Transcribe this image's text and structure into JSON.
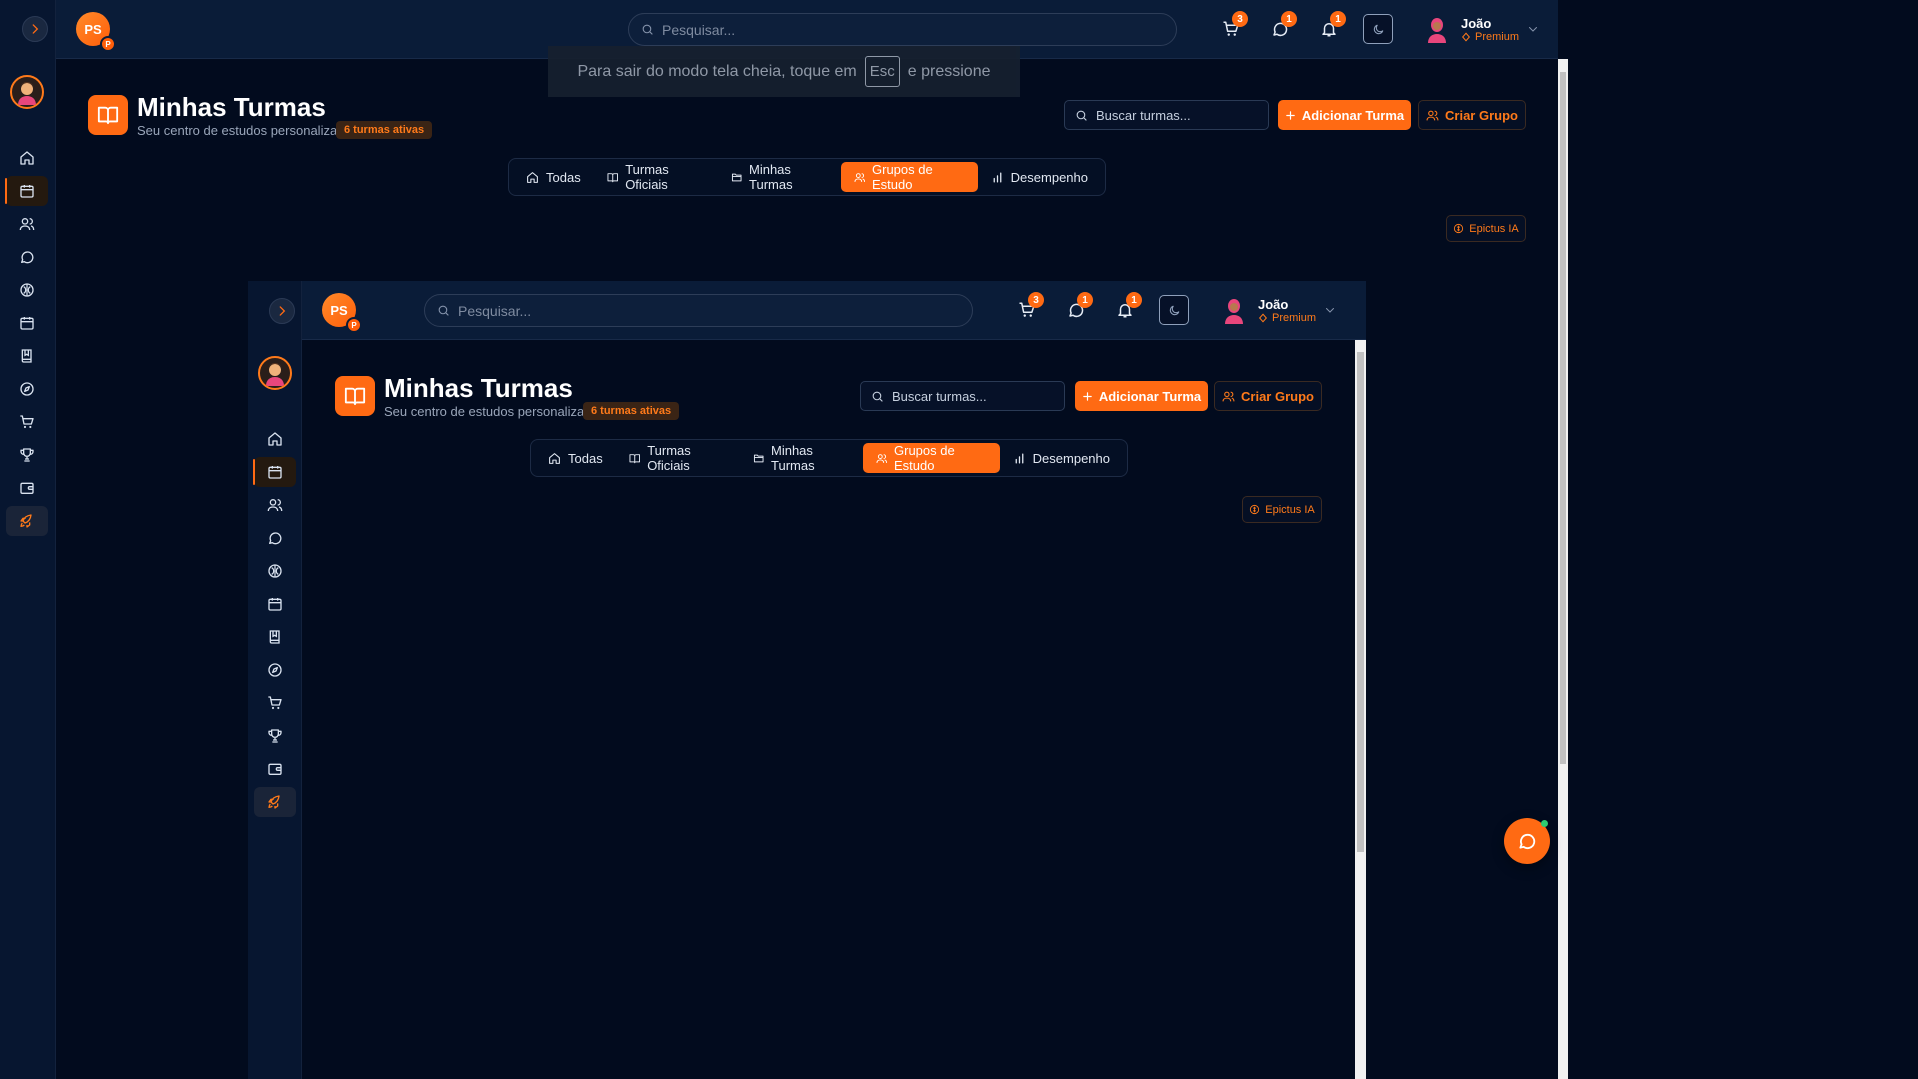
{
  "fullscreen_notice": {
    "before": "Para sair do modo tela cheia, toque em",
    "key": "Esc",
    "after": "e pressione"
  },
  "brand": {
    "initials": "PS",
    "sub": "P"
  },
  "search": {
    "placeholder": "Pesquisar..."
  },
  "counts": {
    "cart": "3",
    "messages": "1",
    "notifications": "1"
  },
  "user": {
    "name": "João",
    "plan": "Premium"
  },
  "sidebar": {
    "items": [
      "home-icon",
      "calendar-icon",
      "users-icon",
      "message-icon",
      "brain-icon",
      "calendar-icon",
      "book-icon",
      "compass-icon",
      "cart-icon",
      "trophy-icon",
      "wallet-icon",
      "rocket-icon"
    ],
    "active_index": 1
  },
  "page": {
    "title": "Minhas Turmas",
    "subtitle": "Seu centro de estudos personalizado",
    "active_count": "6 turmas ativas",
    "search_placeholder": "Buscar turmas...",
    "add_label": "Adicionar Turma",
    "group_label": "Criar Grupo",
    "ai_label": "Epictus IA"
  },
  "tabs": [
    {
      "label": "Todas",
      "icon": "home-icon"
    },
    {
      "label": "Turmas Oficiais",
      "icon": "book-open-icon"
    },
    {
      "label": "Minhas Turmas",
      "icon": "folder-icon"
    },
    {
      "label": "Grupos de Estudo",
      "icon": "users-icon",
      "active": true
    },
    {
      "label": "Desempenho",
      "icon": "bar-chart-icon"
    }
  ],
  "colors": {
    "accent": "#ff6a13",
    "background": "#020b1e",
    "topbar": "#0a1c38",
    "sidebar": "#071630"
  }
}
